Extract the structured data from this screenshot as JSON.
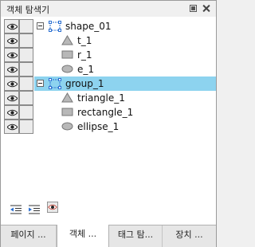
{
  "window": {
    "title": "객체 탐색기"
  },
  "tree": {
    "rows": [
      {
        "label": "shape_01",
        "type": "group",
        "expanded": true
      },
      {
        "label": "t_1",
        "type": "triangle"
      },
      {
        "label": "r_1",
        "type": "rectangle"
      },
      {
        "label": "e_1",
        "type": "ellipse"
      },
      {
        "label": "group_1",
        "type": "group",
        "expanded": true,
        "selected": true
      },
      {
        "label": "triangle_1",
        "type": "triangle"
      },
      {
        "label": "rectangle_1",
        "type": "rectangle"
      },
      {
        "label": "ellipse_1",
        "type": "ellipse"
      }
    ]
  },
  "toolbar": {
    "buttons": [
      {
        "icon": "outdent-icon"
      },
      {
        "icon": "indent-icon"
      },
      {
        "icon": "visibility-toggle-icon"
      }
    ]
  },
  "tabs": [
    {
      "label": "페이지 ..."
    },
    {
      "label": "객체 ...",
      "active": true
    },
    {
      "label": "태그 탐..."
    },
    {
      "label": "장치 ..."
    }
  ],
  "colors": {
    "selection": "#8dd3ef"
  }
}
